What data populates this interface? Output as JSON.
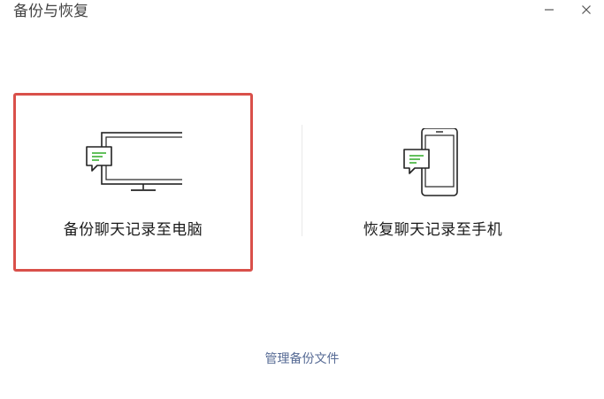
{
  "window": {
    "title": "备份与恢复",
    "minimize_icon": "minimize-icon",
    "close_icon": "close-icon"
  },
  "options": {
    "backup": {
      "label": "备份聊天记录至电脑",
      "icon": "monitor-chat-icon",
      "selected": true
    },
    "restore": {
      "label": "恢复聊天记录至手机",
      "icon": "phone-chat-icon",
      "selected": false
    }
  },
  "footer": {
    "manage_label": "管理备份文件"
  },
  "colors": {
    "selected_border": "#d9504a",
    "link": "#576b95",
    "chat_green": "#3cb034"
  }
}
